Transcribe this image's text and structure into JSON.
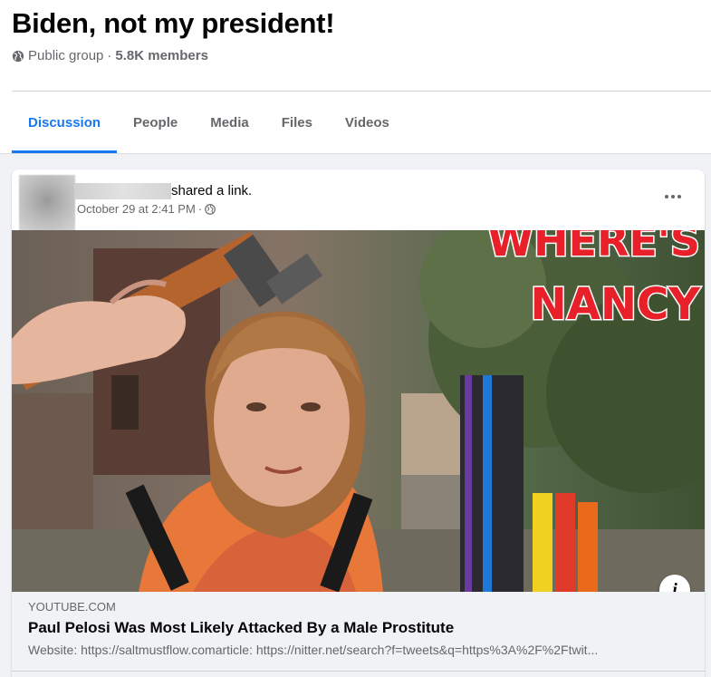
{
  "group": {
    "name": "Biden, not my president!",
    "privacy": "Public group",
    "separator": "·",
    "members": "5.8K members"
  },
  "tabs": [
    {
      "label": "Discussion",
      "active": true
    },
    {
      "label": "People",
      "active": false
    },
    {
      "label": "Media",
      "active": false
    },
    {
      "label": "Files",
      "active": false
    },
    {
      "label": "Videos",
      "active": false
    }
  ],
  "post": {
    "action": "shared a link.",
    "timestamp": "October 29 at 2:41 PM",
    "timestamp_separator": "·",
    "image": {
      "overlay_line1": "WHERE'S",
      "overlay_line2": "NANCY"
    },
    "link": {
      "domain": "YOUTUBE.COM",
      "title": "Paul Pelosi Was Most Likely Attacked By a Male Prostitute",
      "description": "Website: https://saltmustflow.comarticle: https://nitter.net/search?f=tweets&q=https%3A%2F%2Ftwit..."
    }
  },
  "icons": {
    "globe": "globe-icon",
    "more": "more-options-icon",
    "info": "info-icon"
  },
  "colors": {
    "accent": "#1877f2",
    "secondary_text": "#65676b",
    "background": "#f0f2f5",
    "overlay_text": "#e8202a"
  }
}
